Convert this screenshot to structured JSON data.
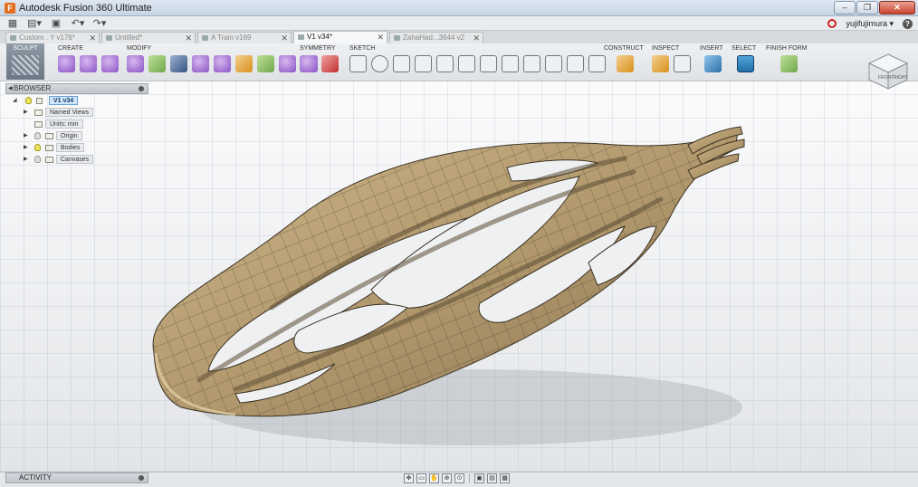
{
  "window": {
    "title": "Autodesk Fusion 360 Ultimate",
    "app_icon": "F"
  },
  "quick_access": {
    "icons": [
      "grid-icon",
      "file-menu-icon",
      "save-icon",
      "undo-icon",
      "redo-icon"
    ],
    "user": "yujifujimura ▾",
    "help": "?"
  },
  "tabs": [
    {
      "label": "Custom . Y v176*",
      "active": false
    },
    {
      "label": "Untitled*",
      "active": false
    },
    {
      "label": "A Train v169",
      "active": false
    },
    {
      "label": "V1 v34*",
      "active": true
    },
    {
      "label": "ZahaHad...3644 v2",
      "active": false
    }
  ],
  "toolbar": {
    "workspace": "SCULPT",
    "groups": {
      "create": "CREATE",
      "modify": "MODIFY",
      "symmetry": "SYMMETRY",
      "sketch": "SKETCH",
      "construct": "CONSTRUCT",
      "inspect": "INSPECT",
      "insert": "INSERT",
      "select": "SELECT",
      "finish_form": "FINISH FORM"
    }
  },
  "browser": {
    "title": "BROWSER",
    "root": "V1 v34",
    "items": [
      "Named Views",
      "Units: mm",
      "Origin",
      "Bodies",
      "Canvases"
    ]
  },
  "activity": {
    "title": "ACTIVITY"
  },
  "viewcube": {
    "front": "FRONT",
    "right": "RIGHT"
  },
  "colors": {
    "model_fill": "#b39a6e",
    "model_edge": "#3c3324",
    "grid": "#a8b0b8",
    "selection": "#2a78b8"
  }
}
